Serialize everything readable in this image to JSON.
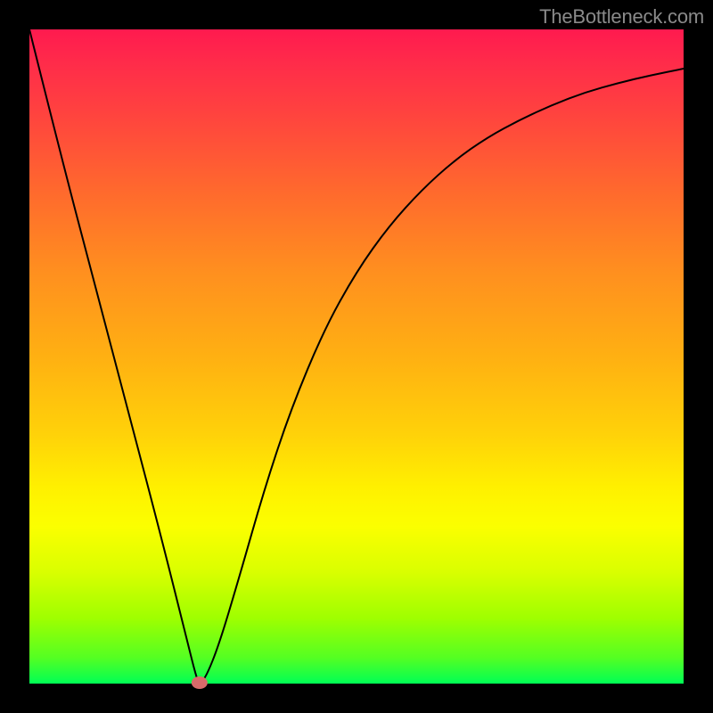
{
  "watermark": "TheBottleneck.com",
  "chart_data": {
    "type": "line",
    "title": "",
    "xlabel": "",
    "ylabel": "",
    "xlim": [
      0,
      1
    ],
    "ylim": [
      0,
      1
    ],
    "series": [
      {
        "name": "bottleneck-curve",
        "x": [
          0.0,
          0.05,
          0.1,
          0.15,
          0.2,
          0.24,
          0.255,
          0.26,
          0.27,
          0.29,
          0.32,
          0.36,
          0.4,
          0.45,
          0.5,
          0.55,
          0.6,
          0.65,
          0.7,
          0.75,
          0.8,
          0.85,
          0.9,
          0.95,
          1.0
        ],
        "y": [
          1.0,
          0.8,
          0.61,
          0.42,
          0.23,
          0.07,
          0.01,
          0.0,
          0.01,
          0.06,
          0.16,
          0.3,
          0.42,
          0.54,
          0.63,
          0.7,
          0.755,
          0.8,
          0.835,
          0.862,
          0.885,
          0.904,
          0.918,
          0.93,
          0.94
        ]
      }
    ],
    "marker": {
      "name": "optimal-point",
      "x": 0.26,
      "y": 0.0
    },
    "grid": false,
    "legend": false
  },
  "colors": {
    "background": "#000000",
    "gradient_top": "#ff1a4f",
    "gradient_bottom": "#00ff55",
    "curve": "#000000",
    "marker": "#d96a6a",
    "watermark": "#8a8a8a"
  }
}
